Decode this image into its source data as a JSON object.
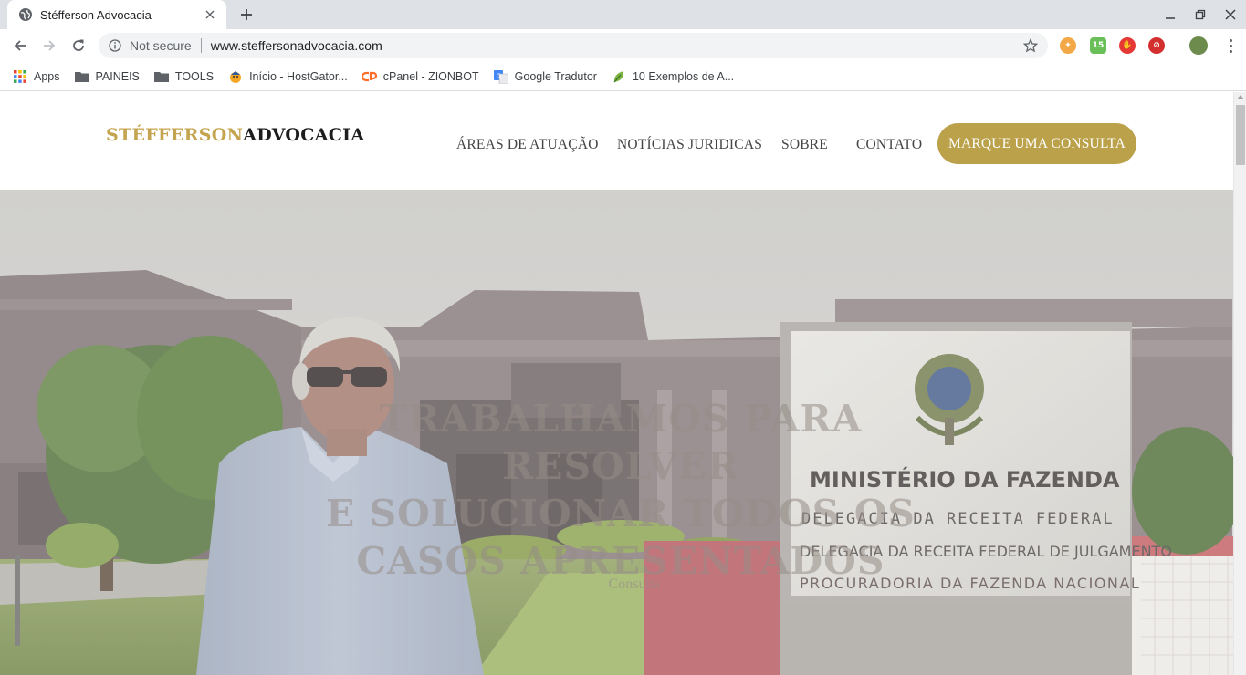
{
  "browser": {
    "tab_title": "Stéfferson Advocacia",
    "security_label": "Not secure",
    "url": "www.steffersonadvocacia.com",
    "extensions": [
      "extension-orange-icon",
      "extension-green-icon",
      "extension-red-hand-icon",
      "extension-red-circle-icon",
      "profile-avatar-icon"
    ]
  },
  "bookmarks": [
    {
      "label": "Apps",
      "icon": "apps-grid-icon"
    },
    {
      "label": "PAINEIS",
      "icon": "folder-icon"
    },
    {
      "label": "TOOLS",
      "icon": "folder-icon"
    },
    {
      "label": "Início - HostGator...",
      "icon": "hostgator-icon"
    },
    {
      "label": "cPanel - ZIONBOT",
      "icon": "cpanel-icon"
    },
    {
      "label": "Google Tradutor",
      "icon": "google-translate-icon"
    },
    {
      "label": "10 Exemplos de A...",
      "icon": "leaf-icon"
    }
  ],
  "site": {
    "logo_part1": "STÉFFERSON",
    "logo_part2": "ADVOCACIA",
    "menu": [
      {
        "label": "ÁREAS DE ATUAÇÃO"
      },
      {
        "label": "NOTÍCIAS JURIDICAS"
      },
      {
        "label": "SOBRE"
      },
      {
        "label": "CONTATO"
      }
    ],
    "cta_label": "MARQUE UMA CONSULTA",
    "colors": {
      "accent": "#bba14a",
      "logo_gold": "#c4a44e"
    }
  },
  "hero": {
    "title_line1": "TRABALHAMOS PARA RESOLVER",
    "title_line2": "E SOLUCIONAR TODOS OS",
    "title_line3": "CASOS APRESENTADOS",
    "link_label": "Consulta",
    "sign_line1": "MINISTÉRIO DA FAZENDA",
    "sign_line2": "DELEGACIA DA RECEITA FEDERAL",
    "sign_line3": "DELEGACIA DA RECEITA FEDERAL DE JULGAMENTO",
    "sign_line4": "PROCURADORIA DA FAZENDA NACIONAL"
  }
}
